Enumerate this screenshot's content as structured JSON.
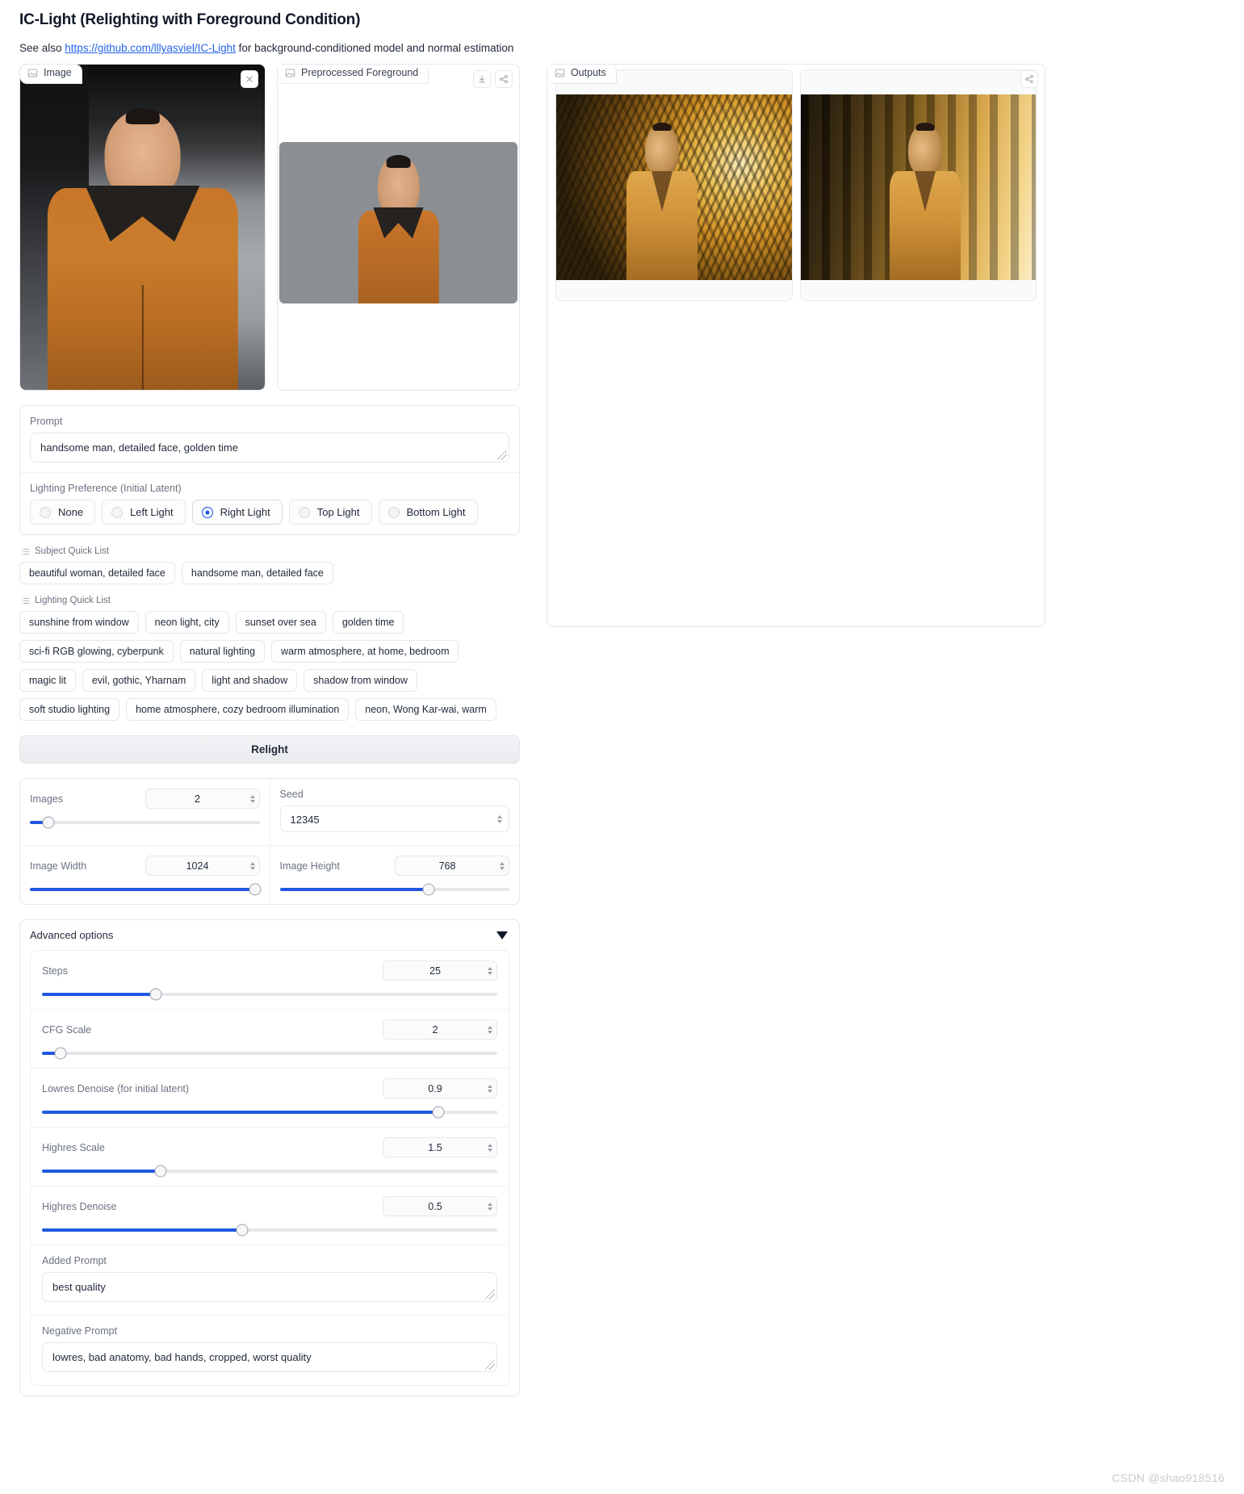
{
  "header": {
    "title": "IC-Light (Relighting with Foreground Condition)",
    "subtitle_prefix": "See also ",
    "link_text": "https://github.com/lllyasviel/IC-Light",
    "subtitle_suffix": " for background-conditioned model and normal estimation"
  },
  "panels": {
    "image_label": "Image",
    "foreground_label": "Preprocessed Foreground",
    "outputs_label": "Outputs",
    "close_icon": "close-icon",
    "download_icon": "download-icon",
    "share_icon": "share-icon",
    "image_icon": "image-placeholder-icon"
  },
  "prompt": {
    "label": "Prompt",
    "value": "handsome man, detailed face, golden time"
  },
  "lighting_preference": {
    "label": "Lighting Preference (Initial Latent)",
    "options": [
      "None",
      "Left Light",
      "Right Light",
      "Top Light",
      "Bottom Light"
    ],
    "selected": "Right Light"
  },
  "subject_quick_list": {
    "label": "Subject Quick List",
    "items": [
      "beautiful woman, detailed face",
      "handsome man, detailed face"
    ]
  },
  "lighting_quick_list": {
    "label": "Lighting Quick List",
    "items": [
      "sunshine from window",
      "neon light, city",
      "sunset over sea",
      "golden time",
      "sci-fi RGB glowing, cyberpunk",
      "natural lighting",
      "warm atmosphere, at home, bedroom",
      "magic lit",
      "evil, gothic, Yharnam",
      "light and shadow",
      "shadow from window",
      "soft studio lighting",
      "home atmosphere, cozy bedroom illumination",
      "neon, Wong Kar-wai, warm"
    ]
  },
  "relight_button": {
    "label": "Relight"
  },
  "basic_settings": {
    "images": {
      "label": "Images",
      "value": "2",
      "percent": 8
    },
    "seed": {
      "label": "Seed",
      "value": "12345"
    },
    "image_width": {
      "label": "Image Width",
      "value": "1024",
      "percent": 98
    },
    "image_height": {
      "label": "Image Height",
      "value": "768",
      "percent": 65
    }
  },
  "advanced": {
    "title": "Advanced options",
    "caret_icon": "chevron-down-icon",
    "sliders": [
      {
        "label": "Steps",
        "value": "25",
        "percent": 25
      },
      {
        "label": "CFG Scale",
        "value": "2",
        "percent": 4
      },
      {
        "label": "Lowres Denoise (for initial latent)",
        "value": "0.9",
        "percent": 87
      },
      {
        "label": "Highres Scale",
        "value": "1.5",
        "percent": 26
      },
      {
        "label": "Highres Denoise",
        "value": "0.5",
        "percent": 44
      }
    ],
    "added_prompt": {
      "label": "Added Prompt",
      "value": "best quality"
    },
    "negative_prompt": {
      "label": "Negative Prompt",
      "value": "lowres, bad anatomy, bad hands, cropped, worst quality"
    }
  },
  "watermark": "CSDN @shao918516",
  "colors": {
    "accent": "#1f57e0",
    "link": "#2563eb",
    "border": "#e5e7eb"
  }
}
